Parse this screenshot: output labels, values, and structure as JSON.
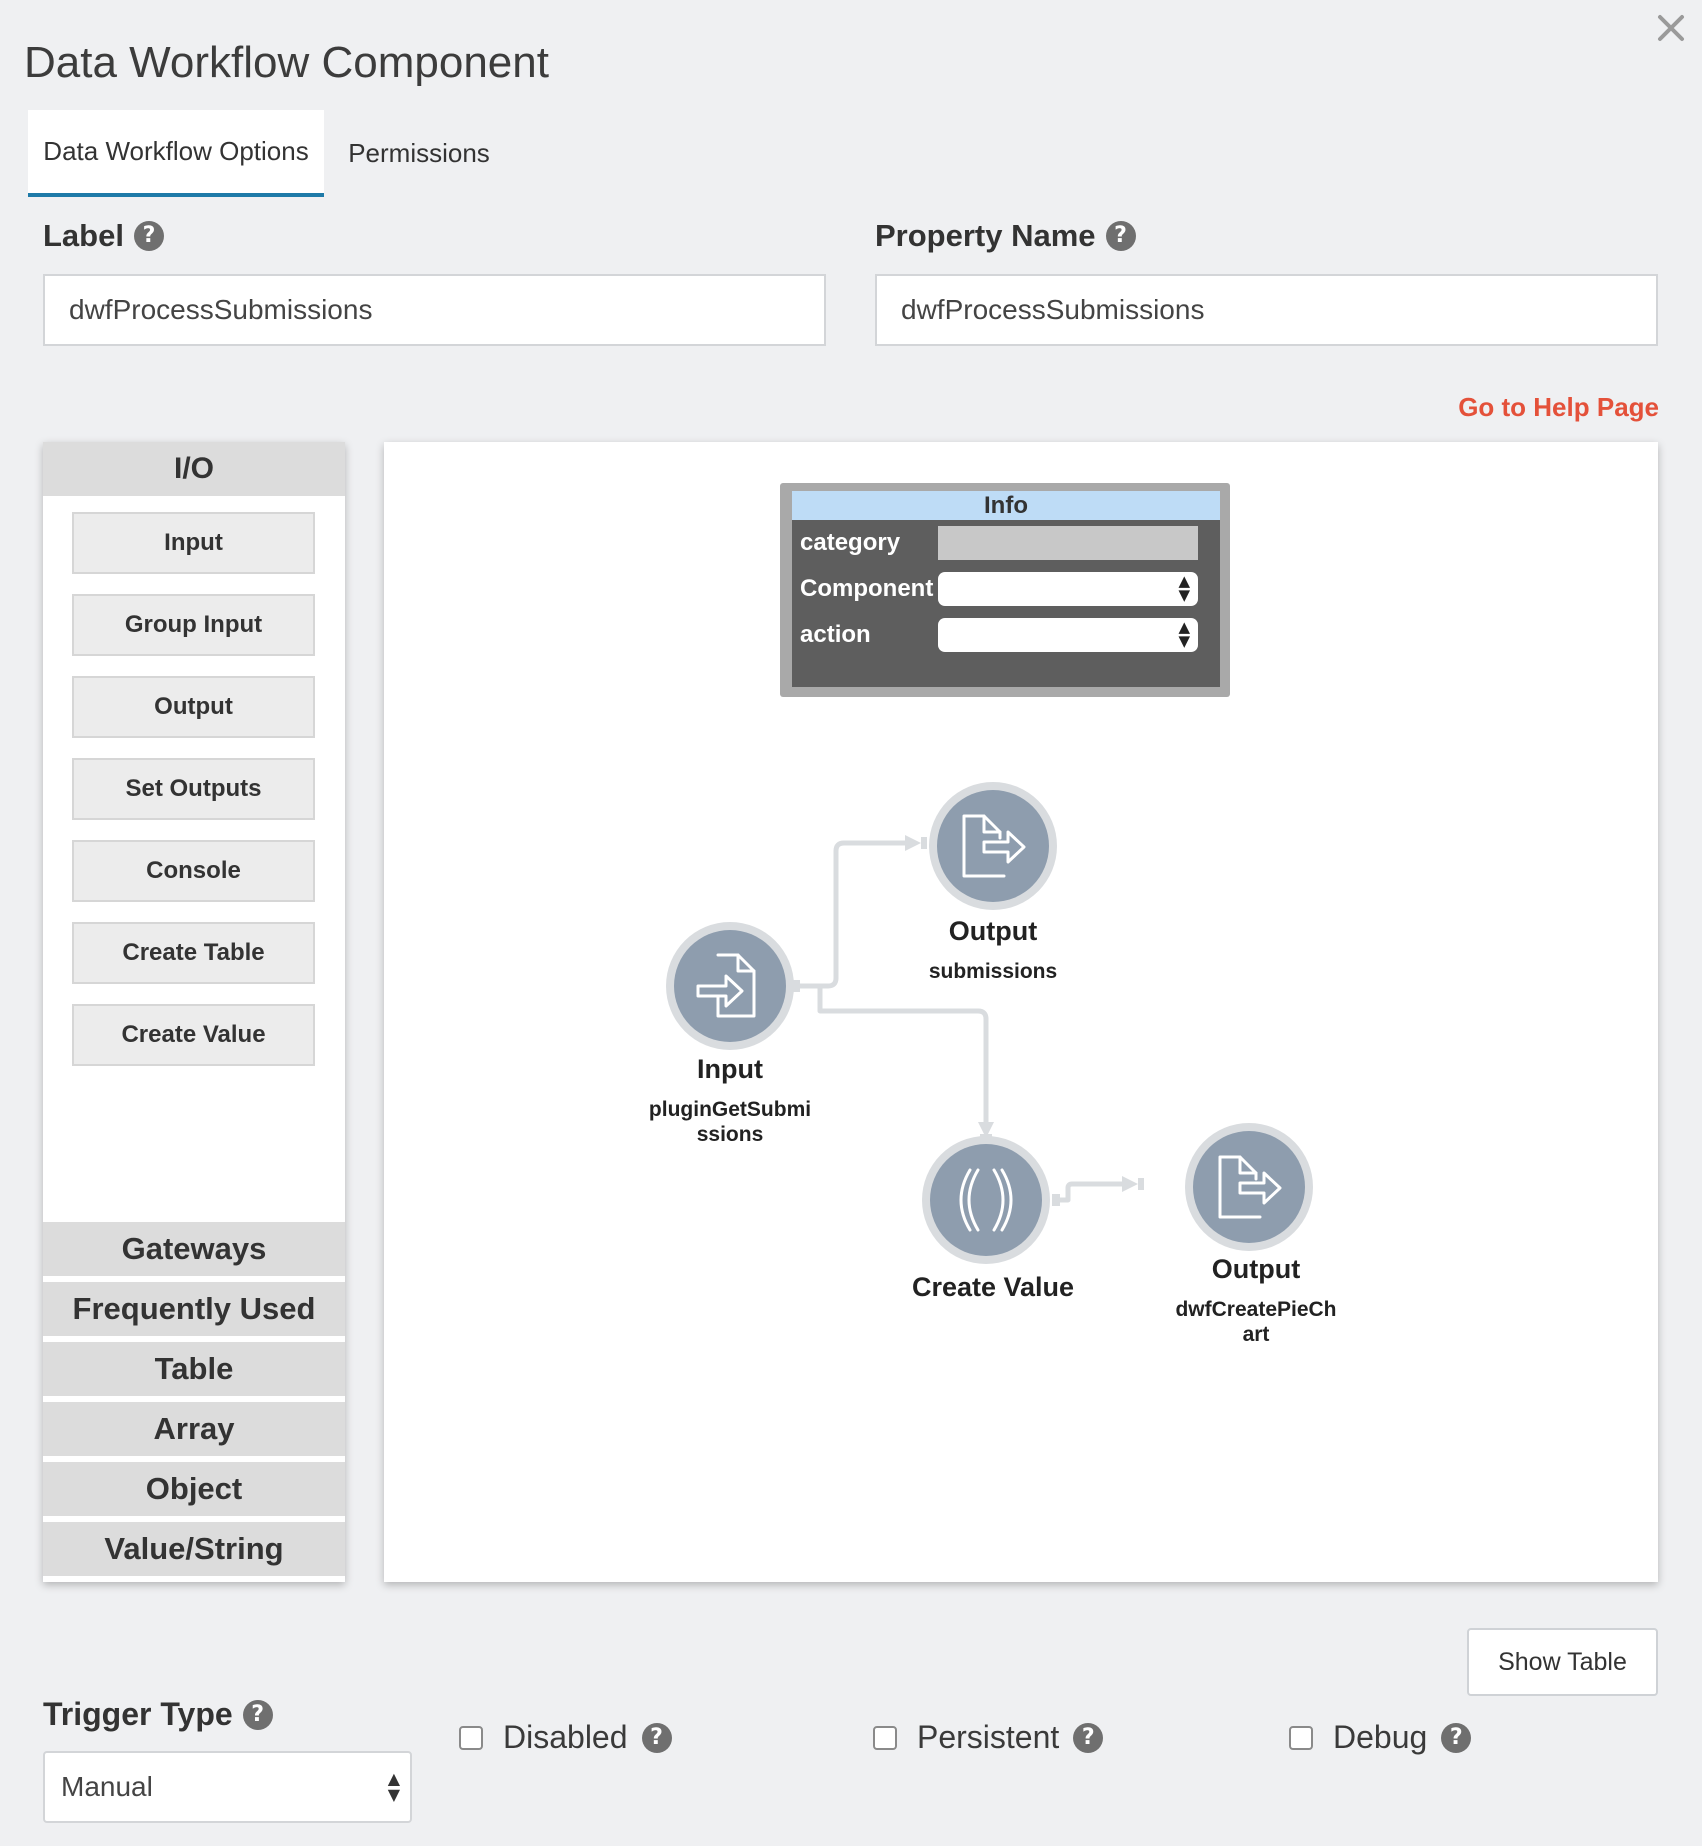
{
  "dialog": {
    "title": "Data Workflow Component",
    "close_icon": "close-icon"
  },
  "tabs": [
    {
      "label": "Data Workflow Options",
      "active": true
    },
    {
      "label": "Permissions",
      "active": false
    }
  ],
  "fields": {
    "label": {
      "label": "Label",
      "value": "dwfProcessSubmissions"
    },
    "property_name": {
      "label": "Property Name",
      "value": "dwfProcessSubmissions"
    }
  },
  "help_link": "Go to Help Page",
  "palette": {
    "header": "I/O",
    "buttons": [
      "Input",
      "Group Input",
      "Output",
      "Set Outputs",
      "Console",
      "Create Table",
      "Create Value"
    ],
    "sections": [
      "Gateways",
      "Frequently Used",
      "Table",
      "Array",
      "Object",
      "Value/String"
    ]
  },
  "info_panel": {
    "title": "Info",
    "rows": [
      "category",
      "Component",
      "action"
    ]
  },
  "nodes": {
    "input": {
      "title": "Input",
      "sub": "pluginGetSubmi\nssions",
      "icon": "file-import-icon"
    },
    "output_submissions": {
      "title": "Output",
      "sub": "submissions",
      "icon": "file-export-icon"
    },
    "create_value": {
      "title": "Create Value",
      "icon": "parentheses-icon"
    },
    "output_chart": {
      "title": "Output",
      "sub": "dwfCreatePieCh\nart",
      "icon": "file-export-icon"
    }
  },
  "show_table": "Show Table",
  "trigger": {
    "label": "Trigger Type",
    "value": "Manual"
  },
  "checkboxes": [
    {
      "label": "Disabled",
      "checked": false
    },
    {
      "label": "Persistent",
      "checked": false
    },
    {
      "label": "Debug",
      "checked": false
    }
  ],
  "colors": {
    "tab_underline": "#1e7aa8",
    "help_link": "#e4513a",
    "node_fill": "#8e9dae",
    "info_header": "#bedcf6"
  }
}
